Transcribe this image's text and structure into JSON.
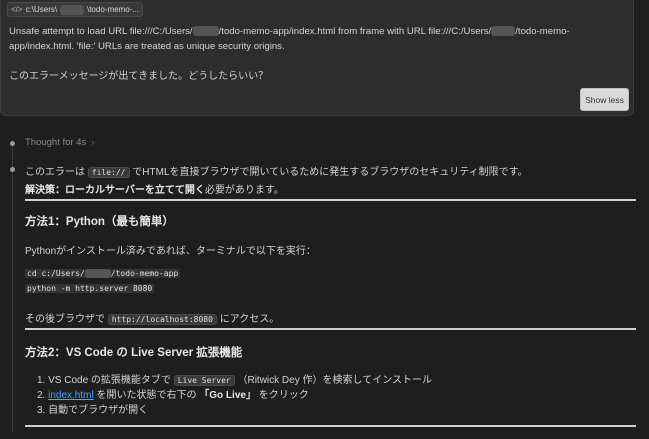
{
  "user_message": {
    "file_chip": {
      "prefix": "c:\\Users\\",
      "suffix": "\\todo-memo-..."
    },
    "error_line1": "Unsafe attempt to load URL file:///C:/Users/",
    "error_line1_mid": "/todo-memo-app/index.html from frame with URL file:///C:/Users/",
    "error_line1_end": "/todo-memo-",
    "error_line2": "app/index.html. 'file:' URLs are treated as unique security origins.",
    "question": "このエラーメッセージが出てきました。どうしたらいい？",
    "show_less_label": "Show less"
  },
  "thought": {
    "label": "Thought for 4s"
  },
  "answer": {
    "intro_pre": "このエラーは",
    "intro_code": "file://",
    "intro_post": "でHTMLを直接ブラウザで開いているために発生するブラウザのセキュリティ制限です。",
    "solution_bold": "解決策：ローカルサーバーを立てて開く",
    "solution_rest": "必要があります。",
    "method1": {
      "title": "方法1：Python（最も簡単）",
      "desc": "Pythonがインストール済みであれば、ターミナルで以下を実行：",
      "code_line1_pre": "cd c:/Users/",
      "code_line1_post": "/todo-memo-app",
      "code_line2": "python -m http.server 8080",
      "after_pre": "その後ブラウザで",
      "after_code": "http://localhost:8080",
      "after_post": "にアクセス。"
    },
    "method2": {
      "title": "方法2：VS Code の Live Server 拡張機能",
      "item1_pre": "VS Code の拡張機能タブで",
      "item1_code": "Live Server",
      "item1_post": "（Ritwick Dey 作）を検索してインストール",
      "item2_link": "index.html",
      "item2_mid": "を開いた状態で右下の",
      "item2_bold": "「Go Live」",
      "item2_post": "をクリック",
      "item3": "自動でブラウザが開く",
      "num1": "1.",
      "num2": "2.",
      "num3": "3."
    }
  }
}
